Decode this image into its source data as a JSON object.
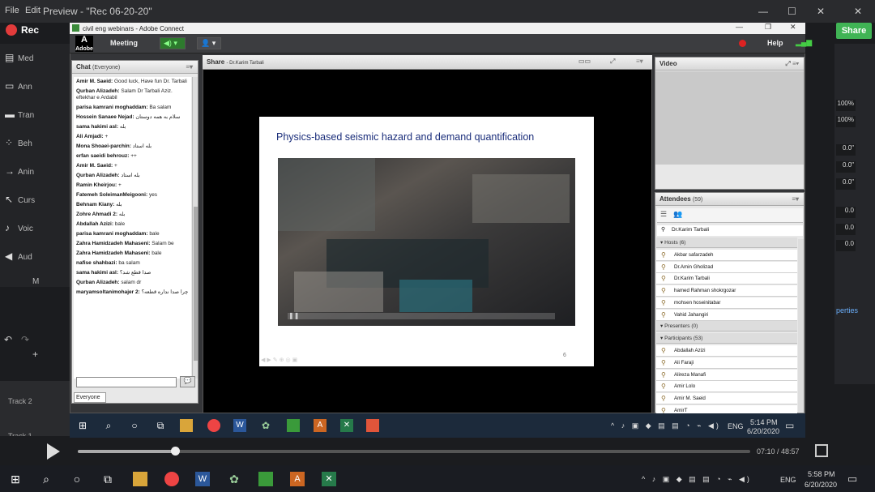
{
  "camtasia": {
    "menu": [
      "File",
      "Edit"
    ],
    "preview_title": "Preview - \"Rec 06-20-20\"",
    "rec_label": "Rec",
    "share_label": "Share",
    "tools": [
      "Med",
      "Ann",
      "Tran",
      "Beh",
      "Anin",
      "Curs",
      "Voic",
      "Aud"
    ],
    "m_label": "M",
    "tracks": [
      "Track 2",
      "Track 1"
    ],
    "right_values": [
      "100%",
      "100%",
      "0.0\"",
      "0.0\"",
      "0.0\"",
      "0.0",
      "0.0",
      "0.0"
    ],
    "properties_link": "perties",
    "playhead_position_pct": 14.5,
    "time": "07:10 / 48:57",
    "window_buttons": [
      "—",
      "☐",
      "✕"
    ]
  },
  "adobe_connect": {
    "window_title": "civil eng webinars - Adobe Connect",
    "logo_text": "Adobe",
    "meeting_menu": "Meeting",
    "help_label": "Help",
    "chat": {
      "title": "Chat",
      "audience": "(Everyone)",
      "to_label": "Everyone",
      "messages": [
        {
          "name": "Amir M. Saeid:",
          "text": "Good luck, Have fun Dr. Tarbali"
        },
        {
          "name": "Qurban Alizadeh:",
          "text": "Salam Dr Tarbali Aziz. eftekhar e Ardabil"
        },
        {
          "name": "parisa kamrani moghaddam:",
          "text": "Ba salam"
        },
        {
          "name": "Hossein Sanaee Nejad:",
          "text": "سلام به همه دوستان"
        },
        {
          "name": "sama hakimi asl:",
          "text": "بله"
        },
        {
          "name": "Ali Amjadi:",
          "text": "+"
        },
        {
          "name": "Mona Shoaei-parchin:",
          "text": "بله استاد"
        },
        {
          "name": "erfan saeidi behrouz:",
          "text": "++"
        },
        {
          "name": "Amir M. Saeid:",
          "text": "+"
        },
        {
          "name": "Qurban Alizadeh:",
          "text": "بله استاد"
        },
        {
          "name": "Ramin Kheirjou:",
          "text": "+"
        },
        {
          "name": "Fatemeh SoleimanMeigooni:",
          "text": "yes"
        },
        {
          "name": "Behnam Kiany:",
          "text": "بله"
        },
        {
          "name": "Zohre Ahmadi 2:",
          "text": "بله"
        },
        {
          "name": "Abdallah Azizi:",
          "text": "bale"
        },
        {
          "name": "parisa kamrani moghaddam:",
          "text": "bale"
        },
        {
          "name": "Zahra Hamidzadeh Mahaseni:",
          "text": "Salam be"
        },
        {
          "name": "Zahra Hamidzadeh Mahaseni:",
          "text": "bale"
        },
        {
          "name": "nafise shahbazi:",
          "text": "ba salam"
        },
        {
          "name": "sama hakimi asl:",
          "text": "صدا قطع شد؟"
        },
        {
          "name": "Qurban Alizadeh:",
          "text": "salam dr"
        },
        {
          "name": "maryamsoltanimohajer 2:",
          "text": "چرا صدا نداره قطعه؟"
        }
      ]
    },
    "share": {
      "title": "Share",
      "presenter": "- Dr.Karim Tarbali",
      "slide_title": "Physics-based seismic hazard and demand quantification",
      "slide_page": "6"
    },
    "video": {
      "title": "Video"
    },
    "attendees": {
      "title": "Attendees",
      "count": "(59)",
      "presenter": "Dr.Karim Tarbali",
      "hosts_label": "Hosts (6)",
      "hosts": [
        "Akbar safarzadeh",
        "Dr.Amin Gholizad",
        "Dr.Karim Tarbali",
        "hamed Rahman shokrgozar",
        "mohsen hoseinitabar",
        "Vahid Jahangiri"
      ],
      "presenters_label": "Presenters (0)",
      "participants_label": "Participants (53)",
      "participants": [
        "Abdallah Azizi",
        "Ali Faraji",
        "Alireza Manafi",
        "Amir Lolo",
        "Amir M. Saeid",
        "AmirT"
      ]
    }
  },
  "inner_taskbar": {
    "lang": "ENG",
    "time": "5:14 PM",
    "date": "6/20/2020"
  },
  "outer_taskbar": {
    "lang": "ENG",
    "time": "5:58 PM",
    "date": "6/20/2020"
  },
  "colors": {
    "accent_green": "#40b455",
    "rec_red": "#e23b3b",
    "slide_title": "#1a2d7a"
  }
}
